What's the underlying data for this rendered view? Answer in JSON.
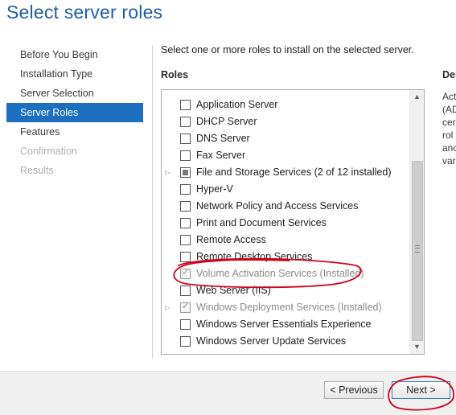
{
  "page": {
    "title": "Select server roles",
    "instruction": "Select one or more roles to install on the selected server.",
    "roles_heading": "Roles",
    "description_heading": "Des",
    "description_lines": [
      "Act",
      "(AD",
      "cer",
      "rol",
      "anc",
      "var"
    ]
  },
  "nav": {
    "items": [
      {
        "label": "Before You Begin",
        "state": "normal"
      },
      {
        "label": "Installation Type",
        "state": "normal"
      },
      {
        "label": "Server Selection",
        "state": "normal"
      },
      {
        "label": "Server Roles",
        "state": "active"
      },
      {
        "label": "Features",
        "state": "normal"
      },
      {
        "label": "Confirmation",
        "state": "disabled"
      },
      {
        "label": "Results",
        "state": "disabled"
      }
    ]
  },
  "roles": {
    "items": [
      {
        "label": "Application Server",
        "checked": false,
        "installed": false,
        "expandable": false
      },
      {
        "label": "DHCP Server",
        "checked": false,
        "installed": false,
        "expandable": false
      },
      {
        "label": "DNS Server",
        "checked": false,
        "installed": false,
        "expandable": false
      },
      {
        "label": "Fax Server",
        "checked": false,
        "installed": false,
        "expandable": false
      },
      {
        "label": "File and Storage Services (2 of 12 installed)",
        "checked": "partial",
        "installed": false,
        "expandable": true
      },
      {
        "label": "Hyper-V",
        "checked": false,
        "installed": false,
        "expandable": false
      },
      {
        "label": "Network Policy and Access Services",
        "checked": false,
        "installed": false,
        "expandable": false
      },
      {
        "label": "Print and Document Services",
        "checked": false,
        "installed": false,
        "expandable": false
      },
      {
        "label": "Remote Access",
        "checked": false,
        "installed": false,
        "expandable": false
      },
      {
        "label": "Remote Desktop Services",
        "checked": false,
        "installed": false,
        "expandable": false
      },
      {
        "label": "Volume Activation Services (Installed)",
        "checked": true,
        "installed": true,
        "expandable": false
      },
      {
        "label": "Web Server (IIS)",
        "checked": false,
        "installed": false,
        "expandable": false
      },
      {
        "label": "Windows Deployment Services (Installed)",
        "checked": true,
        "installed": true,
        "expandable": true
      },
      {
        "label": "Windows Server Essentials Experience",
        "checked": false,
        "installed": false,
        "expandable": false
      },
      {
        "label": "Windows Server Update Services",
        "checked": false,
        "installed": false,
        "expandable": false
      }
    ]
  },
  "footer": {
    "previous_label": "< Previous",
    "next_label": "Next >"
  },
  "colors": {
    "title": "#1f5fa8",
    "nav_active_bg": "#1c6fbf",
    "annotation": "#d0021b"
  }
}
